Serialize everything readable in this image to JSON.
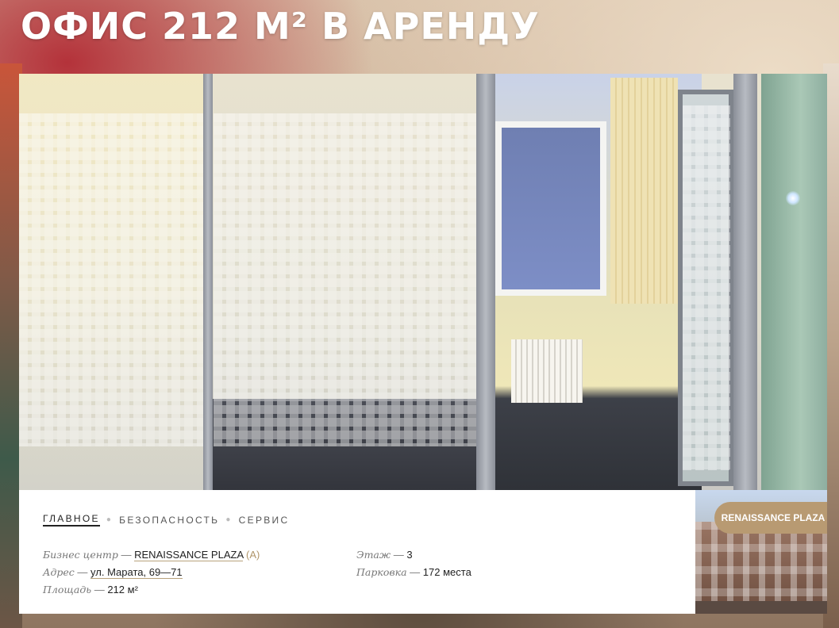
{
  "page": {
    "title": "ОФИС 212 М² В АРЕНДУ"
  },
  "tabs": [
    {
      "label": "ГЛАВНОЕ",
      "active": true
    },
    {
      "label": "БЕЗОПАСНОСТЬ",
      "active": false
    },
    {
      "label": "СЕРВИС",
      "active": false
    }
  ],
  "details": {
    "business_center": {
      "label": "Бизнес центр",
      "value": "RENAISSANCE PLAZA",
      "class": "(A)"
    },
    "address": {
      "label": "Адрес",
      "value": "ул. Марата, 69—71"
    },
    "area": {
      "label": "Площадь",
      "value": "212 м²"
    },
    "floor": {
      "label": "Этаж",
      "value": "3"
    },
    "parking": {
      "label": "Парковка",
      "value": "172 места"
    },
    "separator": "—"
  },
  "building_badge": {
    "label": "RENAISSANCE PLAZA"
  },
  "colors": {
    "accent": "#b89a72",
    "text": "#333333",
    "label": "#777777",
    "title": "#ffffff"
  }
}
